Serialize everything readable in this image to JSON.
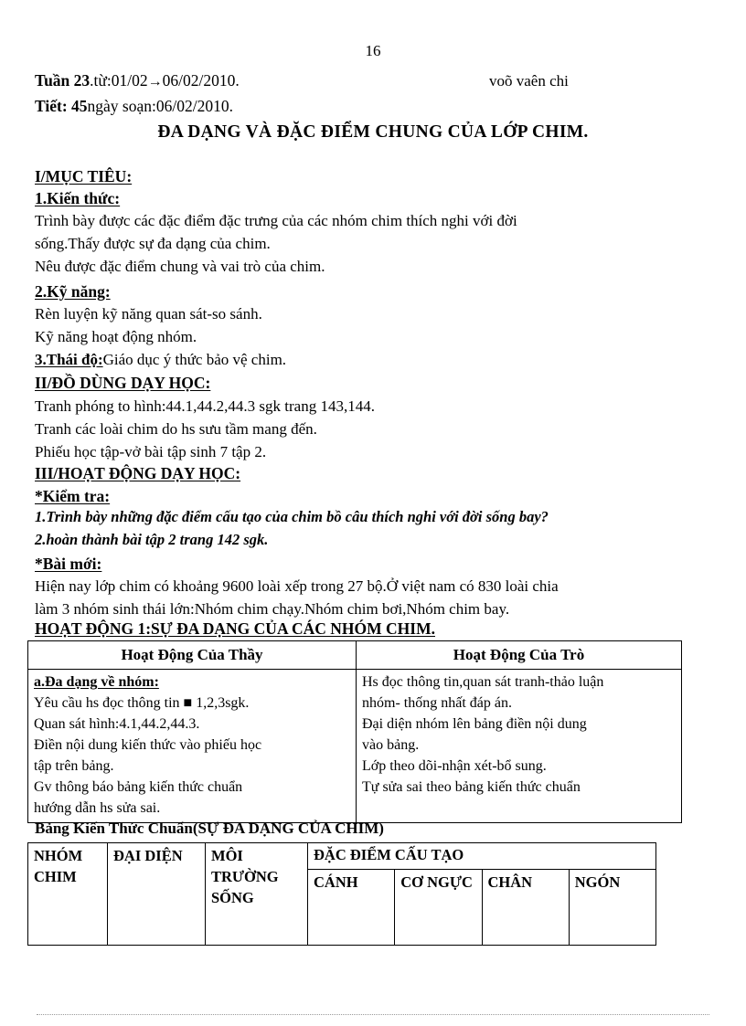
{
  "page": {
    "number": "16"
  },
  "header": {
    "line1_left_bold": "Tuần 23",
    "line1_left_rest": ".từ:01/02",
    "line1_arrow": "→",
    "line1_left_tail": "06/02/2010.",
    "line1_right": "voõ vaên chi",
    "line2_bold": "Tiết: 45",
    "line2_rest": "ngày soạn:06/02/2010."
  },
  "title": "ĐA DẠNG VÀ ĐẶC ĐIỂM CHUNG CỦA LỚP CHIM.",
  "sections": {
    "s1_heading": "I/MỤC TIÊU:",
    "s1_sub1": "1.Kiến thức:",
    "s1_sub1_l1": "Trình bày được các đặc điểm đặc trưng của các nhóm chim thích nghi với đời",
    "s1_sub1_l2": "sống.Thấy được sự đa dạng của chim.",
    "s1_sub1_l3": "Nêu được đặc điểm chung và vai trò của chim.",
    "s1_sub2": "2.Kỹ năng:",
    "s1_sub2_l1": "Rèn luyện kỹ năng quan sát-so sánh.",
    "s1_sub2_l2": "Kỹ năng hoạt động nhóm.",
    "s1_sub3_label": "3.Thái độ:",
    "s1_sub3_text": "Giáo dục ý thức bảo vệ chim.",
    "s2_heading": "II/ĐỒ DÙNG DẠY HỌC:",
    "s2_l1": "Tranh phóng to hình:44.1,44.2,44.3 sgk trang 143,144.",
    "s2_l2": "Tranh các loài chim do hs sưu tầm mang đến.",
    "s2_l3": "Phiếu học tập-vở bài tập sinh 7 tập 2.",
    "s3_heading": "III/HOẠT ĐỘNG DẠY HỌC:",
    "s3_kiemtra": "*Kiểm tra:",
    "s3_kiemtra_q1": "1.Trình bày những đặc điểm cấu tạo của chim bồ câu thích nghi với đời sống bay?",
    "s3_kiemtra_q2": "2.hoàn thành bài tập 2 trang 142 sgk.",
    "s3_baimoi": "*Bài mới:",
    "s3_baimoi_l1": "Hiện nay lớp chim có khoảng 9600 loài xếp trong 27 bộ.Ở việt nam có 830 loài chia",
    "s3_baimoi_l2": "làm 3 nhóm sinh thái lớn:Nhóm chim chạy.Nhóm chim bơi,Nhóm chim bay.",
    "s3_hoatdong1": "HOẠT ĐỘNG 1:SỰ ĐA DẠNG CỦA CÁC NHÓM CHIM."
  },
  "activity_table": {
    "headers": [
      "Hoạt Động Của Thầy",
      "Hoạt Động Của Trò"
    ],
    "teacher_lines": [
      "a.Đa dạng về nhóm:",
      "Yêu cầu hs đọc thông tin ■ 1,2,3sgk.",
      "Quan sát hình:4.1,44.2,44.3.",
      "Điền nội dung kiến thức vào phiếu học",
      "tập trên bảng.",
      "Gv thông báo bảng kiến thức chuẩn",
      "hướng dẫn hs sửa sai."
    ],
    "student_lines": [
      "Hs đọc thông tin,quan sát tranh-thảo luận",
      "nhóm- thống nhất đáp án.",
      "Đại diện nhóm lên bảng điền nội dung",
      "vào bảng.",
      "Lớp theo dõi-nhận xét-bổ sung.",
      "Tự sửa sai theo bảng kiến thức chuẩn"
    ]
  },
  "knowledge_table": {
    "caption": "Bảng Kiến Thức Chuẩn(SỰ ĐA DẠNG CỦA CHIM)",
    "col1": "NHÓM CHIM",
    "col2": "ĐẠI DIỆN",
    "col3": "MÔI TRƯỜNG SỐNG",
    "group_header": "ĐẶC ĐIỂM CẤU TẠO",
    "sub_cols": [
      "CÁNH",
      "CƠ NGỰC",
      "CHÂN",
      "NGÓN"
    ]
  }
}
